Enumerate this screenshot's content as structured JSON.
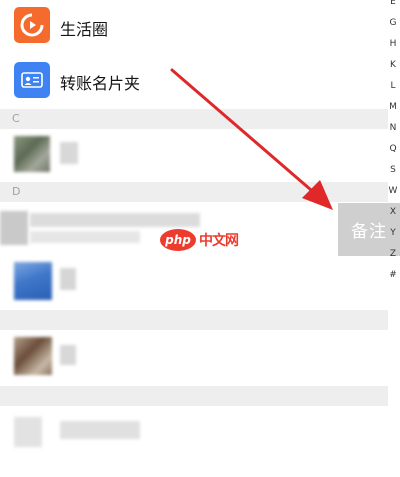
{
  "contacts": {
    "moments": {
      "label": "生活圈",
      "icon": "moments-play-icon",
      "color": "#f56b2d"
    },
    "transfer_cards": {
      "label": "转账名片夹",
      "icon": "contact-card-icon",
      "color": "#3f82f3"
    },
    "sections": [
      {
        "letter": "C"
      },
      {
        "letter": "D"
      },
      {
        "letter": ""
      },
      {
        "letter": ""
      }
    ]
  },
  "index_bar": [
    "E",
    "G",
    "H",
    "K",
    "L",
    "M",
    "N",
    "Q",
    "S",
    "W",
    "X",
    "Y",
    "Z",
    "#"
  ],
  "swipe_action": {
    "label": "备注",
    "color": "#cfcfcf"
  },
  "watermark": {
    "badge": "php",
    "text": "中文网",
    "color": "#ed3b2d"
  },
  "arrow_color": "#e0282a"
}
